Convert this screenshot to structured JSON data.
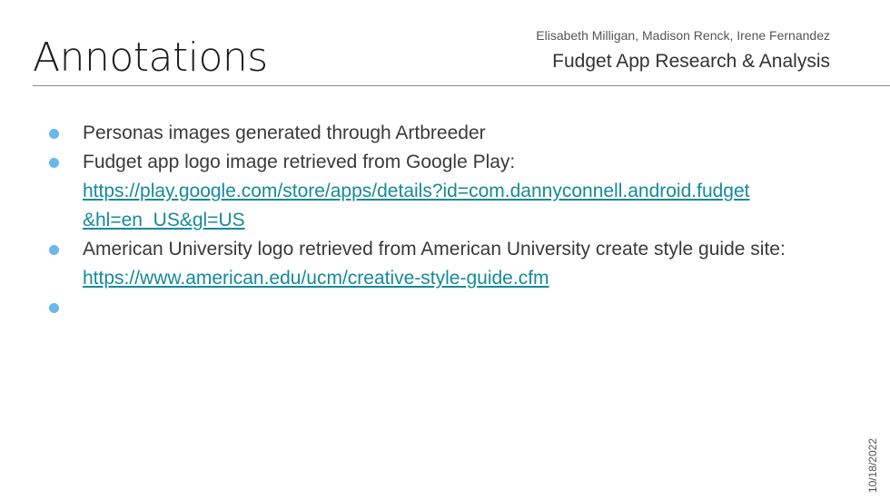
{
  "header": {
    "title": "Annotations",
    "authors": "Elisabeth Milligan, Madison Renck, Irene Fernandez",
    "subtitle": "Fudget App Research & Analysis"
  },
  "bullets": [
    {
      "text": "Personas images generated through Artbreeder"
    },
    {
      "text": "Fudget app logo image retrieved from Google Play:",
      "link_line1": "https://play.google.com/store/apps/details?id=com.dannyconnell.android.fudget",
      "link_line2": "&hl=en_US&gl=US"
    },
    {
      "text": "American University logo retrieved from American University create style guide site: ",
      "link": "https://www.american.edu/ucm/creative-style-guide.cfm"
    },
    {
      "text": ""
    }
  ],
  "footer": {
    "date": "10/18/2022"
  },
  "colors": {
    "bullet": "#6ab7ee",
    "link": "#168a99"
  }
}
